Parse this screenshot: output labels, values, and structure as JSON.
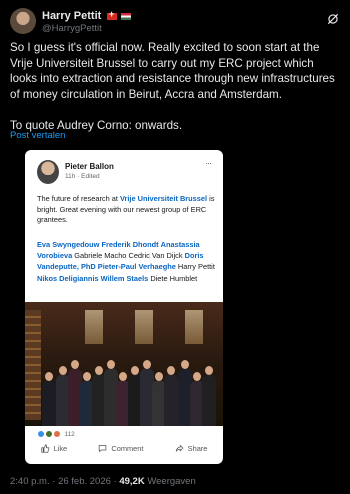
{
  "author": {
    "name": "Harry Pettit",
    "handle": "@HarrygPettit",
    "flags": [
      "swiss-flag",
      "hungarian-flag"
    ]
  },
  "tweet": {
    "text": "So I guess it's official now. Really excited to soon start at the Vrije Universiteit Brussel to carry out my ERC project which looks into extraction and resistance through new infrastructures of money circulation in Beirut, Accra and Amsterdam.\n\nTo quote Audrey Corno: onwards.",
    "translate_label": "Post vertalen"
  },
  "linkedin_card": {
    "author_name": "Pieter Ballon",
    "meta": "11h · Edited",
    "more": "···",
    "text_before": "The future of research at ",
    "text_link": "Vrije Universiteit Brussel",
    "text_after": " is bright. Great evening with our newest group of ERC grantees.",
    "tags": [
      {
        "text": "Eva Swyngedouw",
        "link": true
      },
      {
        "text": "Frederik Dhondt",
        "link": true
      },
      {
        "text": "Anastassia Vorobieva",
        "link": true
      },
      {
        "text": "Gabriele Macho",
        "link": false
      },
      {
        "text": "Cedric Van Dijck",
        "link": false
      },
      {
        "text": "Doris Vandeputte, PhD",
        "link": true
      },
      {
        "text": "Pieter-Paul Verhaeghe",
        "link": true
      },
      {
        "text": "Harry Pettit",
        "link": false
      },
      {
        "text": "Nikos Deligiannis",
        "link": true
      },
      {
        "text": "Willem Staels",
        "link": true
      },
      {
        "text": "Diete Humblet",
        "link": false
      }
    ],
    "reaction_count": "112",
    "actions": {
      "like": "Like",
      "comment": "Comment",
      "share": "Share"
    }
  },
  "footer": {
    "time": "2:40 p.m.",
    "separator": " · ",
    "date": "26 feb. 2026",
    "views_count": "49,2K",
    "views_label": " Weergaven"
  }
}
